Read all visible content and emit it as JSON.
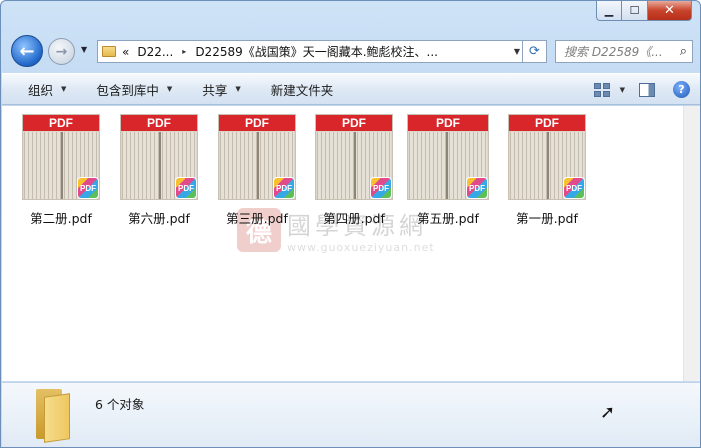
{
  "window": {
    "caption": {
      "minimize_glyph": "▁",
      "maximize_glyph": "☐",
      "close_glyph": "✕"
    }
  },
  "nav": {
    "back_glyph": "←",
    "forward_glyph": "→",
    "history_glyph": "▼",
    "address": {
      "prefix": "«",
      "segments": [
        "D22...",
        "D22589《战国策》天一阁藏本.鲍彪校注、..."
      ],
      "separator": "▸",
      "dropdown_glyph": "▼",
      "refresh_glyph": "⟳"
    },
    "search": {
      "placeholder": "搜索 D22589《...",
      "icon_glyph": "⌕"
    }
  },
  "commands": {
    "organize": "组织",
    "include_in_library": "包含到库中",
    "share": "共享",
    "new_folder": "新建文件夹",
    "dropdown_glyph": "▼",
    "help_glyph": "?"
  },
  "files": [
    {
      "name": "第二册.pdf",
      "band": "PDF",
      "badge": "PDF"
    },
    {
      "name": "第六册.pdf",
      "band": "PDF",
      "badge": "PDF"
    },
    {
      "name": "第三册.pdf",
      "band": "PDF",
      "badge": "PDF"
    },
    {
      "name": "第四册.pdf",
      "band": "PDF",
      "badge": "PDF"
    },
    {
      "name": "第五册.pdf",
      "band": "PDF",
      "badge": "PDF"
    },
    {
      "name": "第一册.pdf",
      "band": "PDF",
      "badge": "PDF"
    }
  ],
  "watermark": {
    "seal": "德",
    "name": "國學資源網",
    "url": "www.guoxueziyuan.net"
  },
  "details": {
    "item_count": "6 个对象"
  },
  "colors": {
    "pdf_band": "#d8262b",
    "accent": "#1f66c9"
  }
}
